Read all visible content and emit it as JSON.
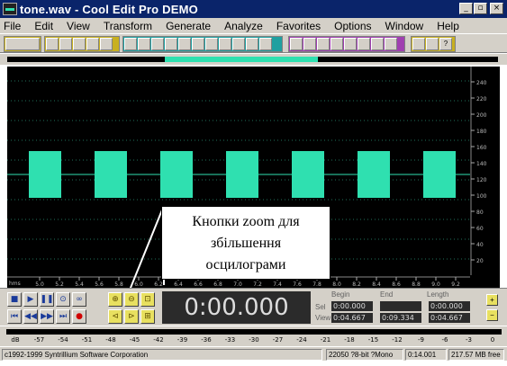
{
  "window": {
    "title": "tone.wav - Cool Edit Pro DEMO"
  },
  "menu": [
    "File",
    "Edit",
    "View",
    "Transform",
    "Generate",
    "Analyze",
    "Favorites",
    "Options",
    "Window",
    "Help"
  ],
  "annotation": {
    "line1": "Кнопки zoom для",
    "line2": "збільшення",
    "line3": "осцилограми"
  },
  "time": "0:00.000",
  "selection": {
    "headers": [
      "Begin",
      "End",
      "Length"
    ],
    "sel_label": "Sel",
    "view_label": "View",
    "sel_begin": "0:00.000",
    "sel_end": "",
    "sel_length": "0:00.000",
    "view_begin": "0:04.667",
    "view_end": "0:09.334",
    "view_length": "0:04.667"
  },
  "right_scale": [
    "240",
    "220",
    "200",
    "180",
    "160",
    "140",
    "120",
    "100",
    "80",
    "60",
    "40",
    "20"
  ],
  "time_ruler": {
    "unit": "hms",
    "ticks": [
      "5.0",
      "5.2",
      "5.4",
      "5.6",
      "5.8",
      "6.0",
      "6.2",
      "6.4",
      "6.6",
      "6.8",
      "7.0",
      "7.2",
      "7.4",
      "7.6",
      "7.8",
      "8.0",
      "8.2",
      "8.4",
      "8.6",
      "8.8",
      "9.0",
      "9.2"
    ]
  },
  "level_ticks": [
    "dB",
    "-57",
    "-54",
    "-51",
    "-48",
    "-45",
    "-42",
    "-39",
    "-36",
    "-33",
    "-30",
    "-27",
    "-24",
    "-21",
    "-18",
    "-15",
    "-12",
    "-9",
    "-6",
    "-3",
    "0"
  ],
  "status": {
    "copyright": "c1992-1999 Syntrillium Software Corporation",
    "format": "22050 ?8-bit ?Mono",
    "duration": "0:14.001",
    "free": "217.57 MB free"
  },
  "colors": {
    "waveform": "#2fe0b0",
    "wave_bg": "#000000",
    "center_line": "#2fe0b0",
    "titlebar": "#0a246a"
  }
}
